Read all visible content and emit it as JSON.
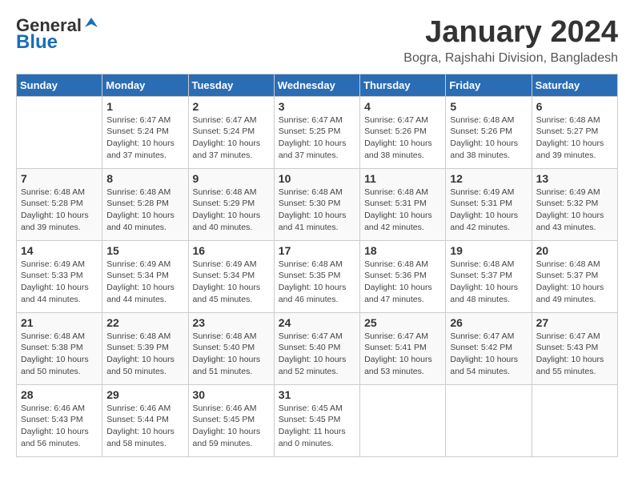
{
  "logo": {
    "line1": "General",
    "line2": "Blue"
  },
  "title": "January 2024",
  "location": "Bogra, Rajshahi Division, Bangladesh",
  "days_header": [
    "Sunday",
    "Monday",
    "Tuesday",
    "Wednesday",
    "Thursday",
    "Friday",
    "Saturday"
  ],
  "weeks": [
    [
      {
        "num": "",
        "text": ""
      },
      {
        "num": "1",
        "text": "Sunrise: 6:47 AM\nSunset: 5:24 PM\nDaylight: 10 hours\nand 37 minutes."
      },
      {
        "num": "2",
        "text": "Sunrise: 6:47 AM\nSunset: 5:24 PM\nDaylight: 10 hours\nand 37 minutes."
      },
      {
        "num": "3",
        "text": "Sunrise: 6:47 AM\nSunset: 5:25 PM\nDaylight: 10 hours\nand 37 minutes."
      },
      {
        "num": "4",
        "text": "Sunrise: 6:47 AM\nSunset: 5:26 PM\nDaylight: 10 hours\nand 38 minutes."
      },
      {
        "num": "5",
        "text": "Sunrise: 6:48 AM\nSunset: 5:26 PM\nDaylight: 10 hours\nand 38 minutes."
      },
      {
        "num": "6",
        "text": "Sunrise: 6:48 AM\nSunset: 5:27 PM\nDaylight: 10 hours\nand 39 minutes."
      }
    ],
    [
      {
        "num": "7",
        "text": "Sunrise: 6:48 AM\nSunset: 5:28 PM\nDaylight: 10 hours\nand 39 minutes."
      },
      {
        "num": "8",
        "text": "Sunrise: 6:48 AM\nSunset: 5:28 PM\nDaylight: 10 hours\nand 40 minutes."
      },
      {
        "num": "9",
        "text": "Sunrise: 6:48 AM\nSunset: 5:29 PM\nDaylight: 10 hours\nand 40 minutes."
      },
      {
        "num": "10",
        "text": "Sunrise: 6:48 AM\nSunset: 5:30 PM\nDaylight: 10 hours\nand 41 minutes."
      },
      {
        "num": "11",
        "text": "Sunrise: 6:48 AM\nSunset: 5:31 PM\nDaylight: 10 hours\nand 42 minutes."
      },
      {
        "num": "12",
        "text": "Sunrise: 6:49 AM\nSunset: 5:31 PM\nDaylight: 10 hours\nand 42 minutes."
      },
      {
        "num": "13",
        "text": "Sunrise: 6:49 AM\nSunset: 5:32 PM\nDaylight: 10 hours\nand 43 minutes."
      }
    ],
    [
      {
        "num": "14",
        "text": "Sunrise: 6:49 AM\nSunset: 5:33 PM\nDaylight: 10 hours\nand 44 minutes."
      },
      {
        "num": "15",
        "text": "Sunrise: 6:49 AM\nSunset: 5:34 PM\nDaylight: 10 hours\nand 44 minutes."
      },
      {
        "num": "16",
        "text": "Sunrise: 6:49 AM\nSunset: 5:34 PM\nDaylight: 10 hours\nand 45 minutes."
      },
      {
        "num": "17",
        "text": "Sunrise: 6:48 AM\nSunset: 5:35 PM\nDaylight: 10 hours\nand 46 minutes."
      },
      {
        "num": "18",
        "text": "Sunrise: 6:48 AM\nSunset: 5:36 PM\nDaylight: 10 hours\nand 47 minutes."
      },
      {
        "num": "19",
        "text": "Sunrise: 6:48 AM\nSunset: 5:37 PM\nDaylight: 10 hours\nand 48 minutes."
      },
      {
        "num": "20",
        "text": "Sunrise: 6:48 AM\nSunset: 5:37 PM\nDaylight: 10 hours\nand 49 minutes."
      }
    ],
    [
      {
        "num": "21",
        "text": "Sunrise: 6:48 AM\nSunset: 5:38 PM\nDaylight: 10 hours\nand 50 minutes."
      },
      {
        "num": "22",
        "text": "Sunrise: 6:48 AM\nSunset: 5:39 PM\nDaylight: 10 hours\nand 50 minutes."
      },
      {
        "num": "23",
        "text": "Sunrise: 6:48 AM\nSunset: 5:40 PM\nDaylight: 10 hours\nand 51 minutes."
      },
      {
        "num": "24",
        "text": "Sunrise: 6:47 AM\nSunset: 5:40 PM\nDaylight: 10 hours\nand 52 minutes."
      },
      {
        "num": "25",
        "text": "Sunrise: 6:47 AM\nSunset: 5:41 PM\nDaylight: 10 hours\nand 53 minutes."
      },
      {
        "num": "26",
        "text": "Sunrise: 6:47 AM\nSunset: 5:42 PM\nDaylight: 10 hours\nand 54 minutes."
      },
      {
        "num": "27",
        "text": "Sunrise: 6:47 AM\nSunset: 5:43 PM\nDaylight: 10 hours\nand 55 minutes."
      }
    ],
    [
      {
        "num": "28",
        "text": "Sunrise: 6:46 AM\nSunset: 5:43 PM\nDaylight: 10 hours\nand 56 minutes."
      },
      {
        "num": "29",
        "text": "Sunrise: 6:46 AM\nSunset: 5:44 PM\nDaylight: 10 hours\nand 58 minutes."
      },
      {
        "num": "30",
        "text": "Sunrise: 6:46 AM\nSunset: 5:45 PM\nDaylight: 10 hours\nand 59 minutes."
      },
      {
        "num": "31",
        "text": "Sunrise: 6:45 AM\nSunset: 5:45 PM\nDaylight: 11 hours\nand 0 minutes."
      },
      {
        "num": "",
        "text": ""
      },
      {
        "num": "",
        "text": ""
      },
      {
        "num": "",
        "text": ""
      }
    ]
  ]
}
